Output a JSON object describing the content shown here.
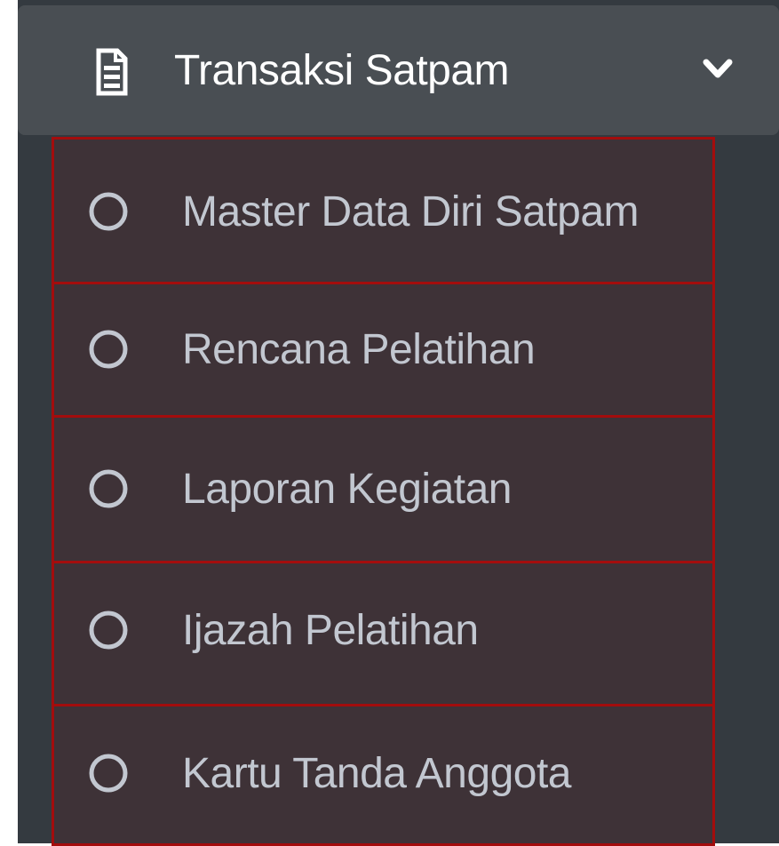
{
  "menu": {
    "header": {
      "title": "Transaksi Satpam",
      "icon": "document-icon",
      "toggle_icon": "chevron-down-icon"
    },
    "items": [
      {
        "label": "Master Data Diri Satpam",
        "icon": "circle-icon"
      },
      {
        "label": "Rencana Pelatihan",
        "icon": "circle-icon"
      },
      {
        "label": "Laporan Kegiatan",
        "icon": "circle-icon"
      },
      {
        "label": "Ijazah Pelatihan",
        "icon": "circle-icon"
      },
      {
        "label": "Kartu Tanda Anggota",
        "icon": "circle-icon"
      }
    ]
  },
  "colors": {
    "sidebar_bg": "#343a40",
    "header_bg": "#494e53",
    "item_bg": "#3e3237",
    "item_border": "#a30d0d",
    "item_text": "#c2c7d0",
    "header_text": "#ffffff"
  }
}
